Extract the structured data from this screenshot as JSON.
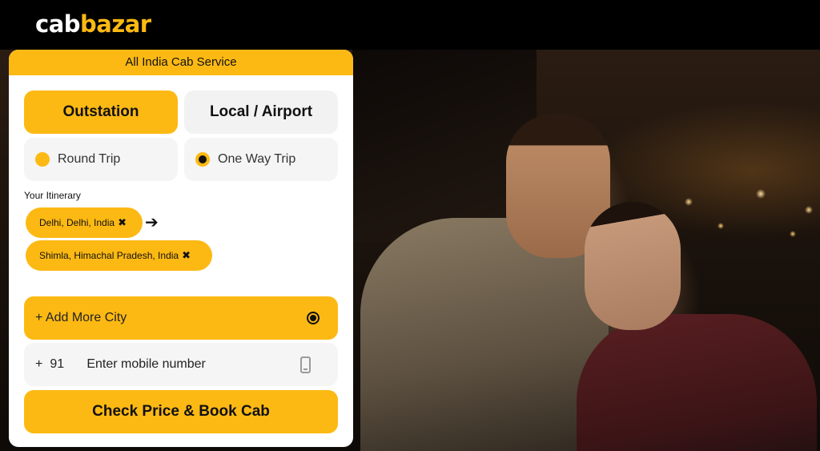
{
  "brand": {
    "part1": "cab",
    "part2": "bazar"
  },
  "card": {
    "title": "All India Cab Service",
    "tabs": [
      {
        "label": "Outstation",
        "active": true
      },
      {
        "label": "Local / Airport",
        "active": false
      }
    ],
    "trip_types": [
      {
        "label": "Round Trip",
        "selected": false
      },
      {
        "label": "One Way Trip",
        "selected": true
      }
    ],
    "itinerary_label": "Your Itinerary",
    "itinerary": [
      {
        "city": "Delhi, Delhi, India",
        "remove": "✖"
      },
      {
        "city": "Shimla, Himachal Pradesh, India",
        "remove": "✖"
      }
    ],
    "arrow": "➔",
    "add_city_label": "+ Add More City",
    "phone": {
      "plus": "+",
      "code": "91",
      "placeholder": "Enter mobile number"
    },
    "submit_label": "Check Price & Book Cab"
  },
  "colors": {
    "accent": "#fdb913",
    "header_bg": "#000000",
    "card_bg": "#ffffff"
  }
}
